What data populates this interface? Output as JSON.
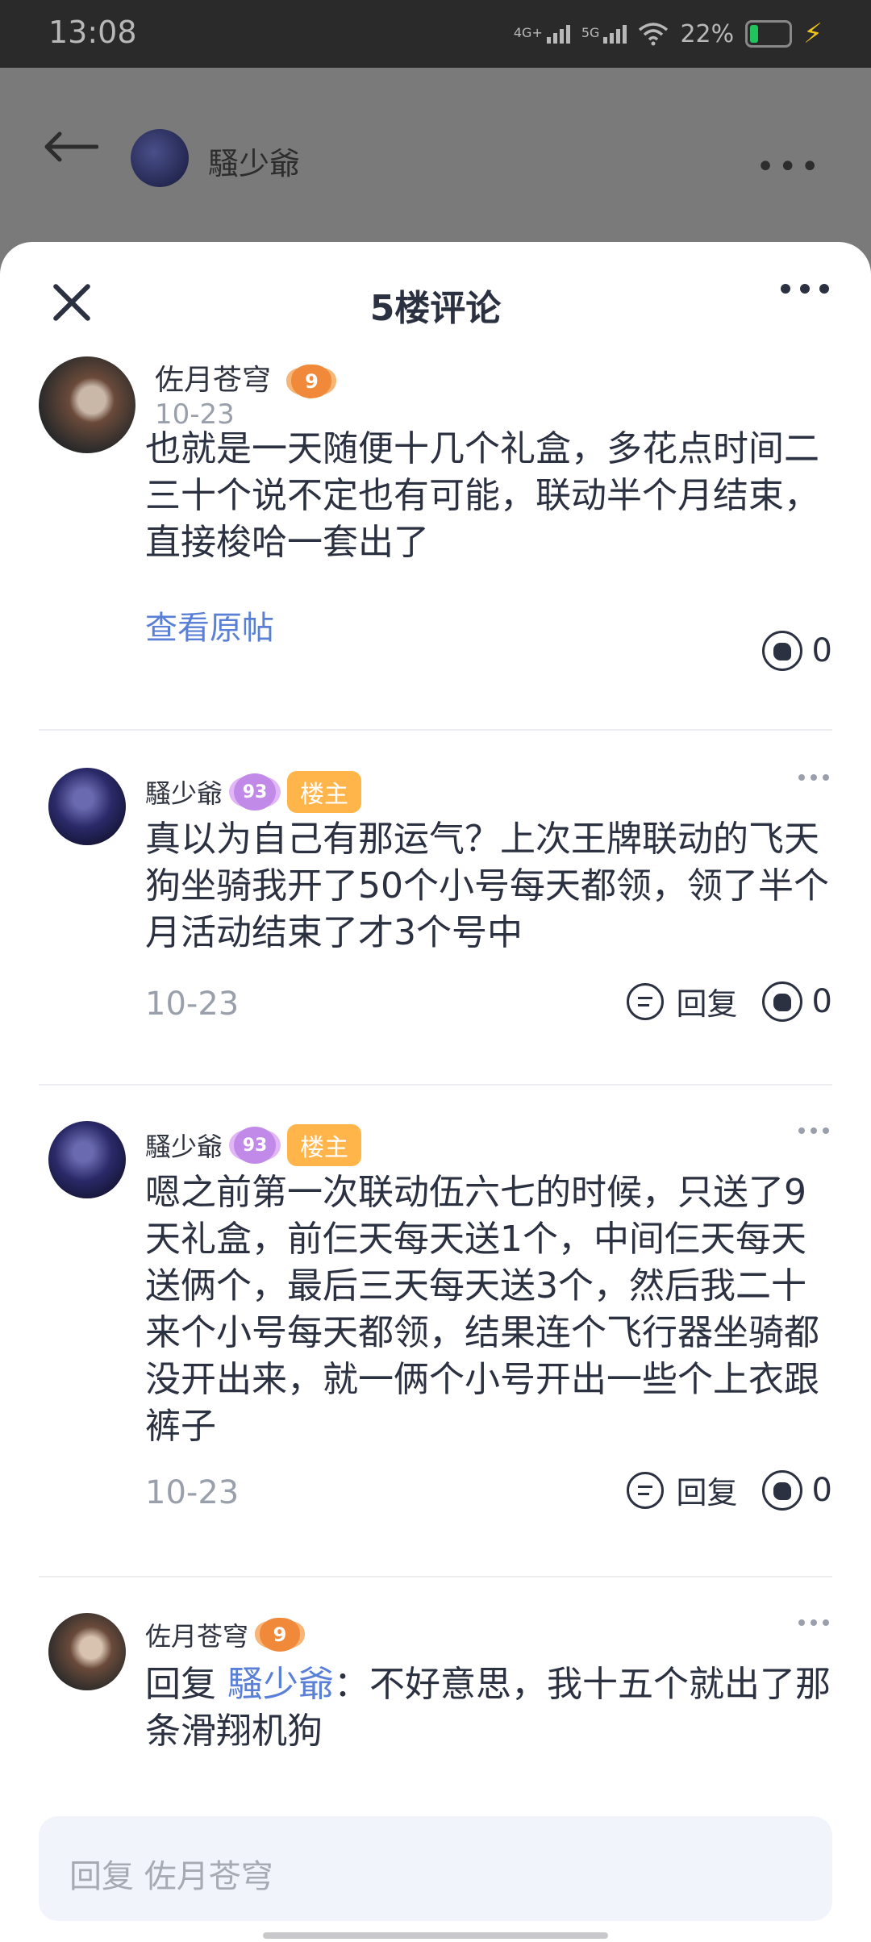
{
  "status_bar": {
    "time": "13:08",
    "signal1_label": "4G+",
    "signal2_label": "5G",
    "battery": "22%",
    "battery_color": "#21c45c"
  },
  "background_page": {
    "back_icon": "arrow-left-icon",
    "username": "騷少爺",
    "more_icon": "more-horizontal-icon"
  },
  "sheet": {
    "title": "5楼评论",
    "close_icon": "close-icon",
    "more_icon": "more-horizontal-icon"
  },
  "main_post": {
    "username": "佐月苍穹",
    "level": "9",
    "date": "10-23",
    "text": "也就是一天随便十几个礼盒，多花点时间二三十个说不定也有可能，联动半个月结束，直接梭哈一套出了",
    "view_original": "查看原帖",
    "like_count": "0"
  },
  "replies": [
    {
      "username": "騷少爺",
      "level": "93",
      "tag": "楼主",
      "text": "真以为自己有那运气？上次王牌联动的飞天狗坐骑我开了50个小号每天都领，领了半个月活动结束了才3个号中",
      "date": "10-23",
      "reply_label": "回复",
      "like_count": "0"
    },
    {
      "username": "騷少爺",
      "level": "93",
      "tag": "楼主",
      "text": "嗯之前第一次联动伍六七的时候，只送了9天礼盒，前仨天每天送1个，中间仨天每天送俩个，最后三天每天送3个，然后我二十来个小号每天都领，结果连个飞行器坐骑都没开出来，就一俩个小号开出一些个上衣跟裤子",
      "date": "10-23",
      "reply_label": "回复",
      "like_count": "0"
    },
    {
      "username": "佐月苍穹",
      "level": "9",
      "reply_prefix": "回复 ",
      "mention": "騷少爺",
      "text": "：不好意思，我十五个就出了那条滑翔机狗"
    }
  ],
  "input": {
    "placeholder": "回复 佐月苍穹"
  },
  "colors": {
    "accent_link": "#5a7fd6",
    "host_tag": "#ffb54a",
    "text_primary": "#2b3140",
    "text_secondary": "#9aa0ab"
  }
}
